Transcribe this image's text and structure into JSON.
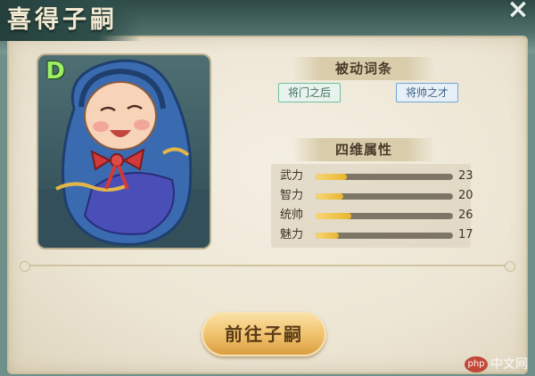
{
  "window": {
    "title": "喜得子嗣",
    "close_icon": "×"
  },
  "portrait": {
    "rank_badge": "D",
    "subject": "swaddled-baby-illustration"
  },
  "passive_traits": {
    "header": "被动词条",
    "tags": [
      {
        "label": "将门之后",
        "color": "#6dbfa3"
      },
      {
        "label": "将帅之才",
        "color": "#6fa7d6"
      }
    ]
  },
  "attributes": {
    "header": "四维属性",
    "max": 100,
    "stats": [
      {
        "label": "武力",
        "value": 23
      },
      {
        "label": "智力",
        "value": 20
      },
      {
        "label": "统帅",
        "value": 26
      },
      {
        "label": "魅力",
        "value": 17
      }
    ]
  },
  "action": {
    "label": "前往子嗣"
  },
  "watermark": {
    "logo": "php",
    "text": "中文网"
  },
  "colors": {
    "accent": "#efc06a",
    "bar_fill": "#e9b52f",
    "bar_track": "#7d7566"
  }
}
